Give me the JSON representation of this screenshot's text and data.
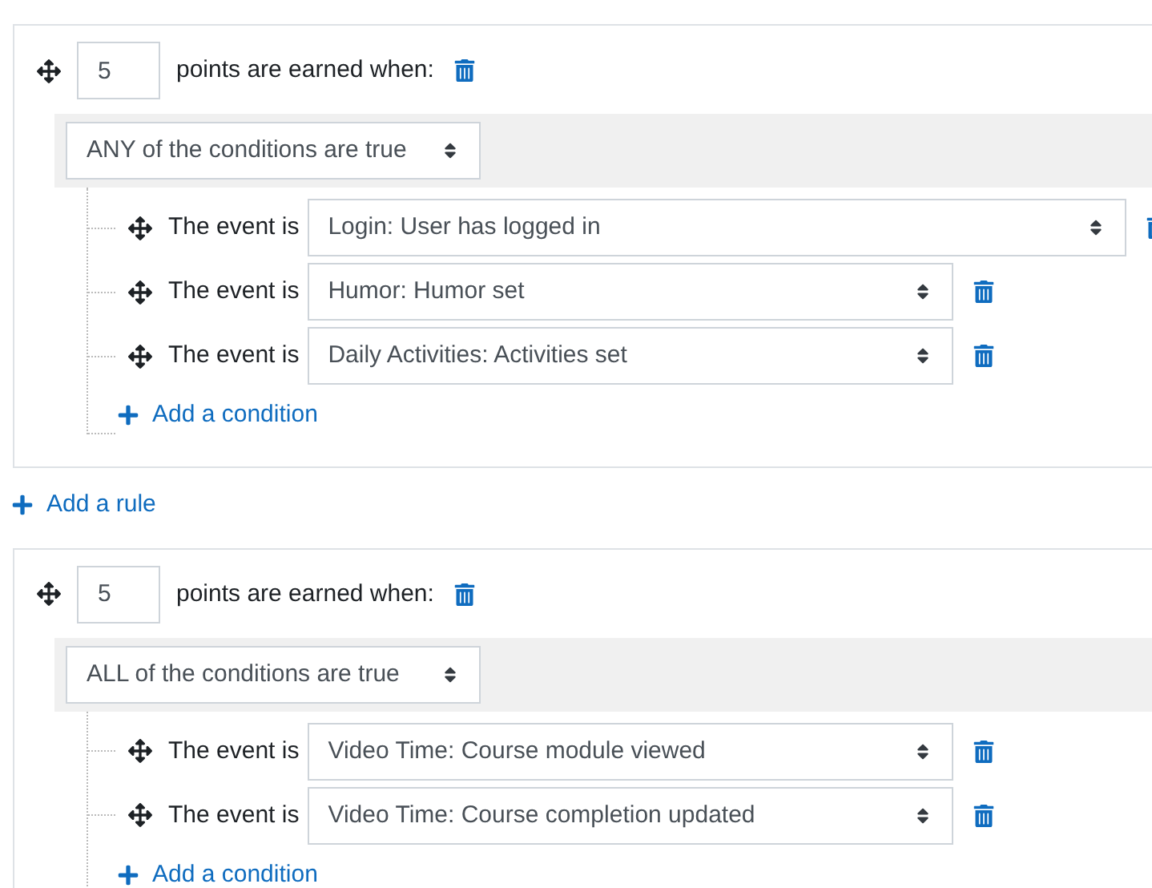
{
  "sections": [
    {
      "kind": "rule",
      "points": "5",
      "label": "points are earned when:",
      "operator": "ANY of the conditions are true",
      "conditions": [
        {
          "label": "The event is",
          "event": "Login: User has logged in",
          "wide": true
        },
        {
          "label": "The event is",
          "event": "Humor: Humor set",
          "wide": false
        },
        {
          "label": "The event is",
          "event": "Daily Activities: Activities set",
          "wide": false
        }
      ],
      "add_condition": "Add a condition"
    },
    {
      "kind": "add_rule",
      "label": "Add a rule"
    },
    {
      "kind": "rule",
      "points": "5",
      "label": "points are earned when:",
      "operator": "ALL of the conditions are true",
      "conditions": [
        {
          "label": "The event is",
          "event": "Video Time: Course module viewed",
          "wide": false
        },
        {
          "label": "The event is",
          "event": "Video Time: Course completion updated",
          "wide": false
        }
      ],
      "add_condition": "Add a condition"
    }
  ]
}
